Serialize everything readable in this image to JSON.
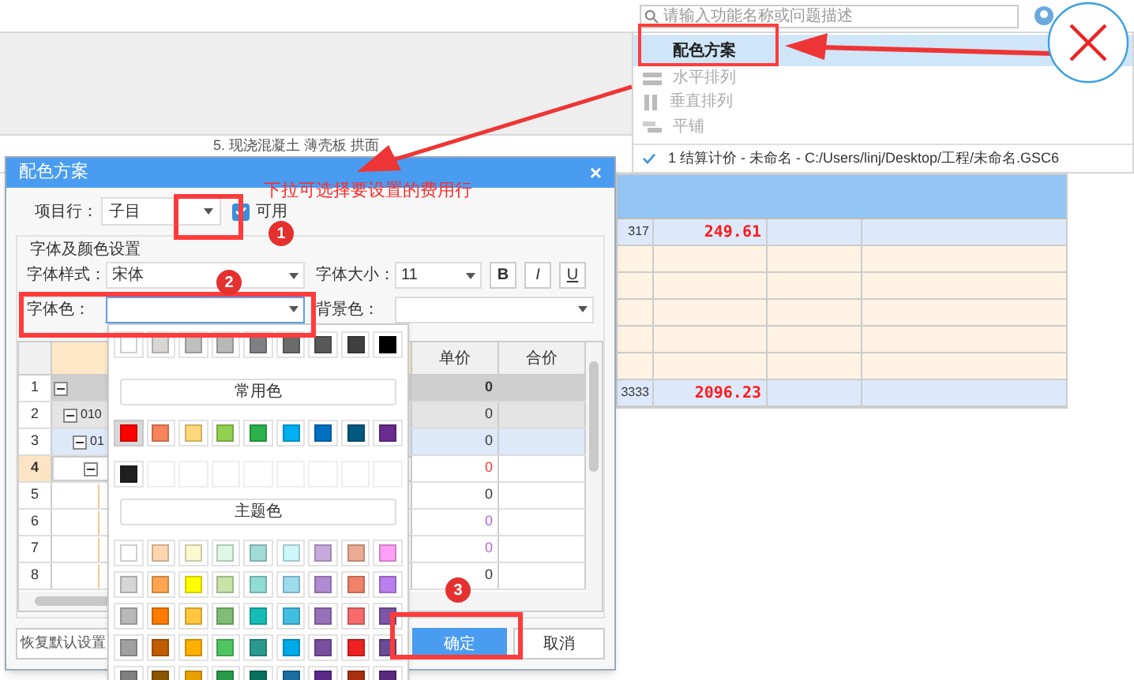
{
  "app": {
    "search": {
      "placeholder": "请输入功能名称或问题描述"
    },
    "breadcrumb": "5. 现浇混凝土 薄壳板 拱面"
  },
  "menu": {
    "items": [
      {
        "label": "配色方案",
        "kind": "plain",
        "selected": true,
        "disabled": false
      },
      {
        "label": "水平排列",
        "kind": "horizontal",
        "selected": false,
        "disabled": true
      },
      {
        "label": "垂直排列",
        "kind": "vertical",
        "selected": false,
        "disabled": true
      },
      {
        "label": "平铺",
        "kind": "tile",
        "selected": false,
        "disabled": true
      }
    ],
    "windows": [
      {
        "label": "1 结算计价 - 未命名 - C:/Users/linj/Desktop/工程/未命名.GSC6",
        "checked": true
      }
    ]
  },
  "sheet": {
    "rows": [
      {
        "kind": "item",
        "number": "317",
        "amount": "249.61"
      },
      {
        "kind": "blank"
      },
      {
        "kind": "blank"
      },
      {
        "kind": "blank"
      },
      {
        "kind": "blank"
      },
      {
        "kind": "blank"
      },
      {
        "kind": "total",
        "number": "3333",
        "amount": "2096.23"
      }
    ]
  },
  "dialog": {
    "title": "配色方案",
    "close": "×",
    "item_row": {
      "label": "项目行：",
      "value": "子目",
      "enabled_label": "可用",
      "enabled": true
    },
    "group_title": "字体及颜色设置",
    "font_style": {
      "label": "字体样式：",
      "value": "宋体"
    },
    "font_size": {
      "label": "字体大小：",
      "value": "11"
    },
    "styles": [
      {
        "label": "B",
        "on": false
      },
      {
        "label": "I",
        "on": false
      },
      {
        "label": "U",
        "on": false
      }
    ],
    "font_color": {
      "label": "字体色："
    },
    "background_color": {
      "label": "背景色："
    },
    "table": {
      "columns": [
        "单价",
        "合价"
      ],
      "rows": [
        {
          "number": "1",
          "price": "0",
          "expanded": true,
          "selected": false,
          "children": [
            {
              "number": "2",
              "code": "010",
              "price": "0",
              "expanded": true,
              "selected": false,
              "children": [
                {
                  "number": "3",
                  "code": "01",
                  "price": "0",
                  "expanded": true,
                  "selected": false,
                  "children": [
                    {
                      "number": "4",
                      "price": "0",
                      "color": "#ff3333",
                      "expanded": true,
                      "selected": true,
                      "children": [
                        {
                          "number": "5",
                          "price": "0",
                          "selected": false
                        },
                        {
                          "number": "6",
                          "price": "0",
                          "color": "#b266d6",
                          "selected": false
                        },
                        {
                          "number": "7",
                          "price": "0",
                          "color": "#b266d6",
                          "selected": false
                        },
                        {
                          "number": "8",
                          "price": "0",
                          "selected": false
                        }
                      ]
                    }
                  ]
                }
              ]
            }
          ]
        }
      ]
    },
    "buttons": {
      "reset": "恢复默认设置",
      "ok": "确定",
      "cancel": "取消"
    }
  },
  "palette": {
    "grays": [
      {
        "color": "#ffffff"
      },
      {
        "color": "#d9d5d5"
      },
      {
        "color": "#bfbfbf"
      },
      {
        "color": "#b8b8b8"
      },
      {
        "color": "#808085"
      },
      {
        "color": "#6b6b6b"
      },
      {
        "color": "#595959"
      },
      {
        "color": "#404040"
      },
      {
        "color": "#000000"
      }
    ],
    "common_label": "常用色",
    "common": [
      {
        "color": "#ff0000",
        "selected": true
      },
      {
        "color": "#f7845a",
        "selected": false
      },
      {
        "color": "#ffd97a",
        "selected": false
      },
      {
        "color": "#92d050",
        "selected": false
      },
      {
        "color": "#2bb24c",
        "selected": false
      },
      {
        "color": "#00b0f0",
        "selected": false
      },
      {
        "color": "#0070c0",
        "selected": false
      },
      {
        "color": "#005a80",
        "selected": false
      },
      {
        "color": "#6a2c91",
        "selected": false
      }
    ],
    "recent": [
      {
        "color": "#202020"
      }
    ],
    "theme_label": "主题色",
    "theme": [
      [
        {
          "color": "#ffffff"
        },
        {
          "color": "#fdd5b0"
        },
        {
          "color": "#fbf9d0"
        },
        {
          "color": "#dcf8e4"
        },
        {
          "color": "#a2dcd6"
        },
        {
          "color": "#ccf7fb"
        },
        {
          "color": "#c8a9dc"
        },
        {
          "color": "#eaaa93"
        },
        {
          "color": "#ff9ff6"
        }
      ],
      [
        {
          "color": "#d6d6d6"
        },
        {
          "color": "#ffa552"
        },
        {
          "color": "#ffff00"
        },
        {
          "color": "#c6e4a8"
        },
        {
          "color": "#90dcd6"
        },
        {
          "color": "#9ddcef"
        },
        {
          "color": "#b08ad2"
        },
        {
          "color": "#f0826c"
        },
        {
          "color": "#bb7eee"
        }
      ],
      [
        {
          "color": "#b8b8b8"
        },
        {
          "color": "#ff7b00"
        },
        {
          "color": "#ffc83d"
        },
        {
          "color": "#7ebd73"
        },
        {
          "color": "#17bcb6"
        },
        {
          "color": "#44bfe4"
        },
        {
          "color": "#9670b8"
        },
        {
          "color": "#f76b6b"
        },
        {
          "color": "#7e55a6"
        }
      ],
      [
        {
          "color": "#a0a0a0"
        },
        {
          "color": "#c05d00"
        },
        {
          "color": "#ffb000"
        },
        {
          "color": "#4fc561"
        },
        {
          "color": "#2a9a90"
        },
        {
          "color": "#00aae7"
        },
        {
          "color": "#7a4fa0"
        },
        {
          "color": "#ee2222"
        },
        {
          "color": "#6b4a96"
        }
      ],
      [
        {
          "color": "#808080"
        },
        {
          "color": "#8a5500"
        },
        {
          "color": "#e8a000"
        },
        {
          "color": "#2a9a4a"
        },
        {
          "color": "#0a7060"
        },
        {
          "color": "#1a6fa0"
        },
        {
          "color": "#5a2a8a"
        },
        {
          "color": "#a83010"
        },
        {
          "color": "#5a2a80"
        }
      ]
    ]
  },
  "annotations": {
    "note": "下拉可选择要设置的费用行",
    "steps": [
      "1",
      "2",
      "3"
    ]
  }
}
